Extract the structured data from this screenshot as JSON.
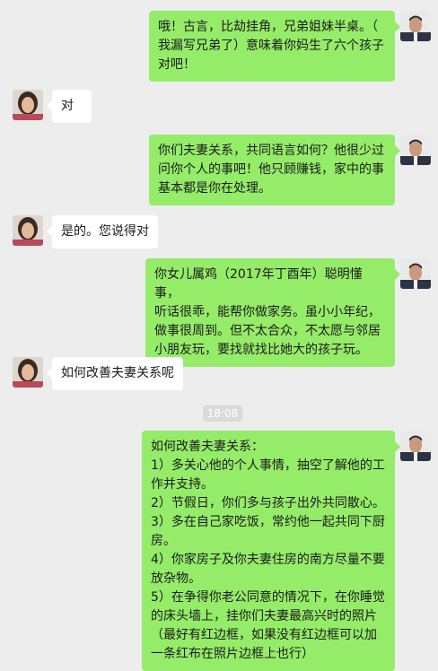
{
  "messages": [
    {
      "side": "out",
      "lines": [
        "哦！古言，比劫挂角，兄弟姐妹半桌。（",
        "我漏写兄弟了）意味着你妈生了六个孩子",
        "对吧！"
      ]
    },
    {
      "side": "in",
      "lines": [
        "对"
      ]
    },
    {
      "side": "out",
      "lines": [
        "你们夫妻关系，共同语言如何？他很少过",
        "问你个人的事吧！他只顾赚钱，家中的事",
        "基本都是你在处理。"
      ]
    },
    {
      "side": "in",
      "lines": [
        "是的。您说得对"
      ]
    },
    {
      "side": "out",
      "lines": [
        "你女儿属鸡（2017年丁酉年）聪明懂事，",
        "听话很乖，能帮你做家务。虽小小年纪，",
        "做事很周到。但不太合众，不太愿与邻居",
        "小朋友玩，要找就找比她大的孩子玩。"
      ]
    },
    {
      "side": "in",
      "lines": [
        "如何改善夫妻关系呢"
      ]
    },
    {
      "side": "out",
      "lines": [
        "如何改善夫妻关系：",
        "1）多关心他的个人事情，抽空了解他的工",
        "作并支持。",
        "2）节假日，你们多与孩子出外共同散心。",
        "3）多在自己家吃饭，常约他一起共同下厨",
        "房。",
        "4）你家房子及你夫妻住房的南方尽量不要",
        "放杂物。",
        "5）在争得你老公同意的情况下，在你睡觉",
        "的床头墙上，挂你们夫妻最高兴时的照片",
        "（最好有红边框，如果没有红边框可以加",
        "一条红布在照片边框上也行）"
      ]
    }
  ],
  "timestamp": "18:08",
  "colors": {
    "background": "#ededed",
    "outgoing_bubble": "#95ec69",
    "incoming_bubble": "#ffffff"
  }
}
